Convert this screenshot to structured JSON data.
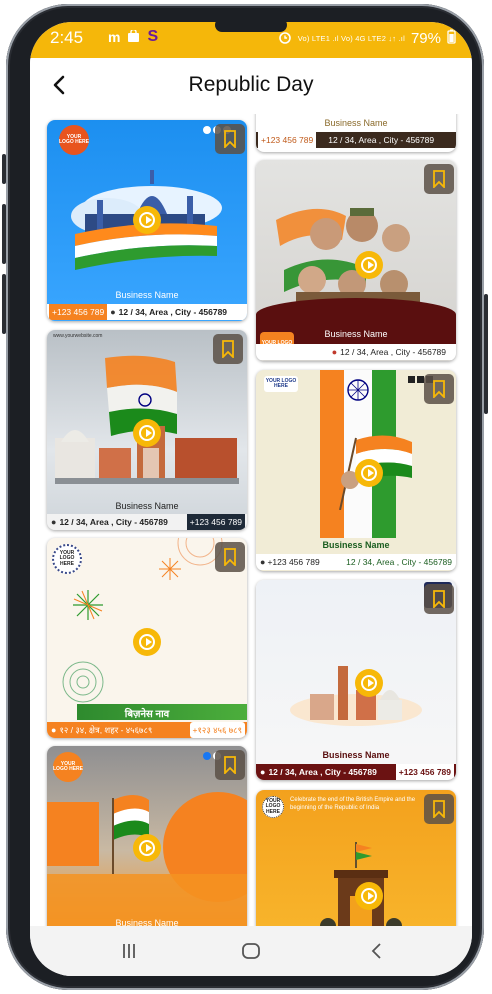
{
  "status_bar": {
    "time": "2:45",
    "app_icons": [
      "m",
      "■",
      "S"
    ],
    "network_text": "Vo) LTE1 .ıl Vo) 4G LTE2 ↓↑ .ıl",
    "battery": "79%"
  },
  "header": {
    "title": "Republic Day"
  },
  "left_column": [
    {
      "business_name": "Business Name",
      "phone": "+123 456 789",
      "address": "12 / 34, Area , City - 456789"
    },
    {
      "website": "www.yourwebsite.com",
      "business_name": "Business Name",
      "phone": "+123 456 789",
      "address": "12 / 34, Area , City - 456789"
    },
    {
      "business_name": "बिज़नेस नाव",
      "phone": "+१२३ ४५६ ७८९",
      "address": "१२ / ३४, क्षेत्र, शहर - ४५६७८९"
    },
    {
      "business_name": "Business Name"
    }
  ],
  "right_column": [
    {
      "business_name": "Business Name",
      "phone": "+123 456 789",
      "address": "12 / 34, Area , City - 456789"
    },
    {
      "business_name": "Business Name",
      "address": "12 / 34, Area , City - 456789"
    },
    {
      "business_name": "Business Name",
      "phone": "+123 456 789",
      "address": "12 / 34, Area , City - 456789"
    },
    {
      "business_name": "Business Name",
      "phone": "+123 456 789",
      "address": "12 / 34, Area , City - 456789"
    },
    {
      "caption": "Celebrate the end of the British Empire and the beginning of the Republic of India"
    }
  ],
  "logo_text": "YOUR LOGO HERE",
  "colors": {
    "accent": "#f5b70a",
    "saffron": "#f58220",
    "green": "#138808",
    "navy": "#000080"
  },
  "icons": {
    "back": "arrow-left-icon",
    "bookmark": "bookmark-icon",
    "play": "play-icon",
    "nav_recents": "recents-icon",
    "nav_home": "home-icon",
    "nav_back": "nav-back-icon"
  }
}
